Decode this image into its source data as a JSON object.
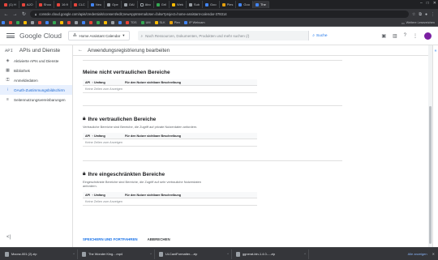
{
  "browser": {
    "tabs": [
      "(1) H",
      "AJO",
      "Shou",
      "16:9",
      "CLC",
      "Neu",
      "Ope",
      "OAI",
      "Abo",
      "Gril",
      "Wek",
      "Sub",
      "Goo",
      "Ples",
      "Goo",
      "The"
    ],
    "url": "console.cloud.google.com/apis/credentials/consent/edit;newAppInternalUser=false?project=home-assistant-calendar-378314",
    "bookmarks": [
      "TDS",
      "UM",
      "SLK",
      "Plex",
      "IP Webcam"
    ],
    "reading_list": "Weitere Lesezeichen"
  },
  "header": {
    "logo": "Google Cloud",
    "project": "Home Assistant Calendar",
    "search_placeholder": "Nach Ressourcen, Dokumenten, Produkten und mehr suchen (/)",
    "search_button": "Suche"
  },
  "sidebar": {
    "api_badge": "API",
    "title": "APIs und Dienste",
    "items": [
      {
        "label": "Aktivierte APIs und Dienste",
        "icon": "◈"
      },
      {
        "label": "Bibliothek",
        "icon": "▦"
      },
      {
        "label": "Anmeldedaten",
        "icon": "⚿"
      },
      {
        "label": "OAuth-Zustimmungsbildschirm",
        "icon": "⁝"
      },
      {
        "label": "Seitennutzungsvereinbarungen",
        "icon": "≡"
      }
    ],
    "collapse": "<|"
  },
  "main": {
    "page_title": "Anwendungsregistrierung bearbeiten",
    "sections": [
      {
        "title": "Meine nicht vertraulichen Bereiche",
        "description": "",
        "col_api": "API",
        "col_scope": "Umfang",
        "col_desc": "Für den Nutzer sichtbare Beschreibung",
        "empty": "Keine Zeilen zum Anzeigen"
      },
      {
        "title": "Ihre vertraulichen Bereiche",
        "description": "Vertrauliche Bereiche sind Bereiche, die Zugriff auf private Nutzerdaten anfordern.",
        "col_api": "API",
        "col_scope": "Umfang",
        "col_desc": "Für den Nutzer sichtbare Beschreibung",
        "empty": "Keine Zeilen zum Anzeigen"
      },
      {
        "title": "Ihre eingeschränkten Bereiche",
        "description": "Eingeschränkte Bereiche sind Bereiche, die Zugriff auf sehr vertrauliche Nutzerdaten anfordern.",
        "col_api": "API",
        "col_scope": "Umfang",
        "col_desc": "Für den Nutzer sichtbare Beschreibung",
        "empty": "Keine Zeilen zum Anzeigen"
      }
    ],
    "save_button": "SPEICHERN UND FORTFAHREN",
    "cancel_button": "ABBRECHEN"
  },
  "downloads": {
    "items": [
      "Moonz-001 (2).zip",
      "The Wonder King....mp4",
      "ULCardFormatter....zip",
      "ggnerat-bin-1.4.0-....zip"
    ],
    "show_all": "Alle anzeigen"
  },
  "colors": {
    "accent": "#1a73e8",
    "chrome_bg": "#202124",
    "active_nav_bg": "#e8f0fe"
  }
}
